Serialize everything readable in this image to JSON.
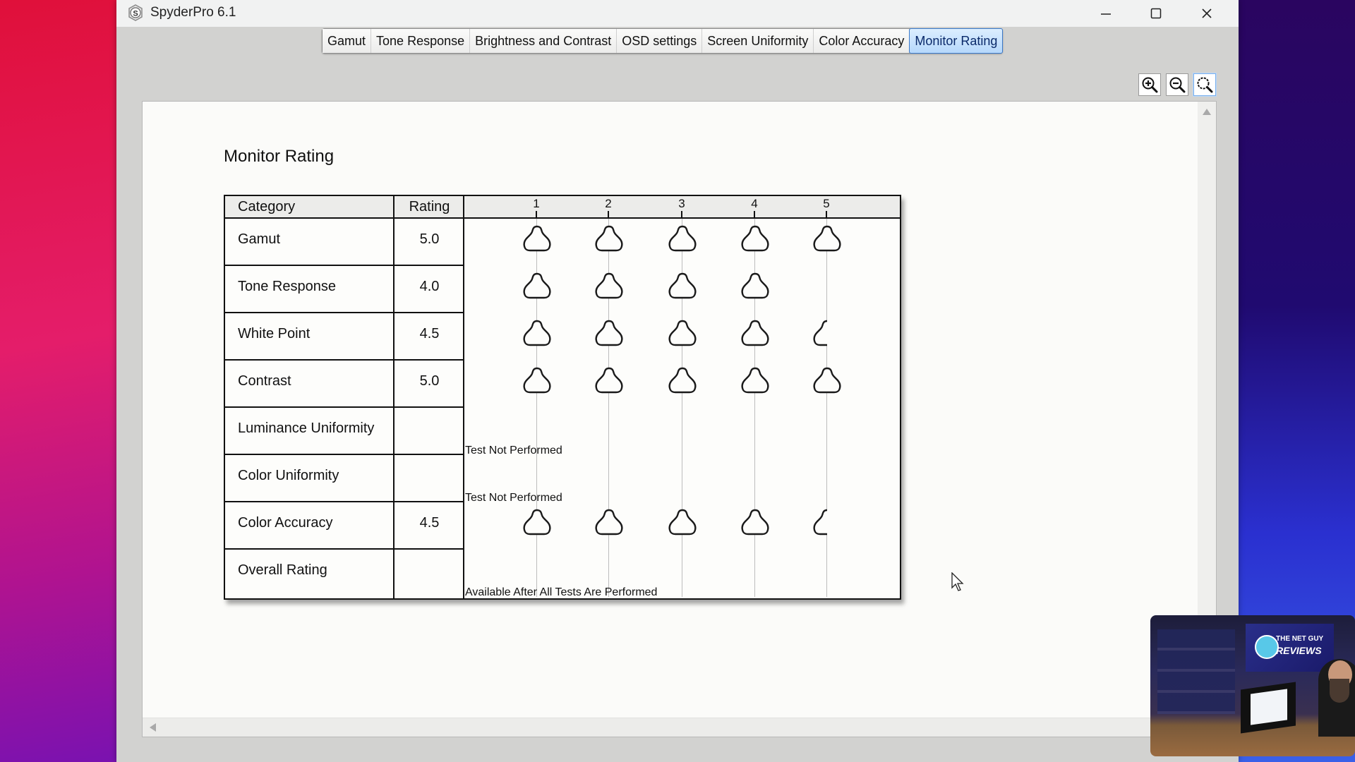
{
  "window": {
    "title": "SpyderPro 6.1",
    "controls": {
      "minimize": "—",
      "maximize": "☐",
      "close": "✕"
    }
  },
  "tabs": [
    {
      "label": "Gamut",
      "active": false
    },
    {
      "label": "Tone Response",
      "active": false
    },
    {
      "label": "Brightness and Contrast",
      "active": false
    },
    {
      "label": "OSD settings",
      "active": false
    },
    {
      "label": "Screen Uniformity",
      "active": false
    },
    {
      "label": "Color Accuracy",
      "active": false
    },
    {
      "label": "Monitor Rating",
      "active": true
    }
  ],
  "zoom_tools": [
    {
      "name": "zoom-in-icon"
    },
    {
      "name": "zoom-out-icon"
    },
    {
      "name": "zoom-fit-icon",
      "selected": true
    }
  ],
  "report": {
    "title": "Monitor Rating",
    "headers": {
      "category": "Category",
      "rating": "Rating"
    },
    "scale": [
      "1",
      "2",
      "3",
      "4",
      "5"
    ],
    "rating_icon": "spyder-icon",
    "rows": [
      {
        "category": "Gamut",
        "rating": "5.0",
        "value": 5.0
      },
      {
        "category": "Tone Response",
        "rating": "4.0",
        "value": 4.0
      },
      {
        "category": "White Point",
        "rating": "4.5",
        "value": 4.5
      },
      {
        "category": "Contrast",
        "rating": "5.0",
        "value": 5.0
      },
      {
        "category": "Luminance Uniformity",
        "rating": "",
        "note": "Test Not Performed"
      },
      {
        "category": "Color Uniformity",
        "rating": "",
        "note": "Test Not Performed"
      },
      {
        "category": "Color Accuracy",
        "rating": "4.5",
        "value": 4.5
      },
      {
        "category": "Overall Rating",
        "rating": "",
        "note": "Available After All Tests Are Performed"
      }
    ]
  },
  "webcam": {
    "banner_line1": "THE NET GUY",
    "banner_line2": "REVIEWS"
  }
}
